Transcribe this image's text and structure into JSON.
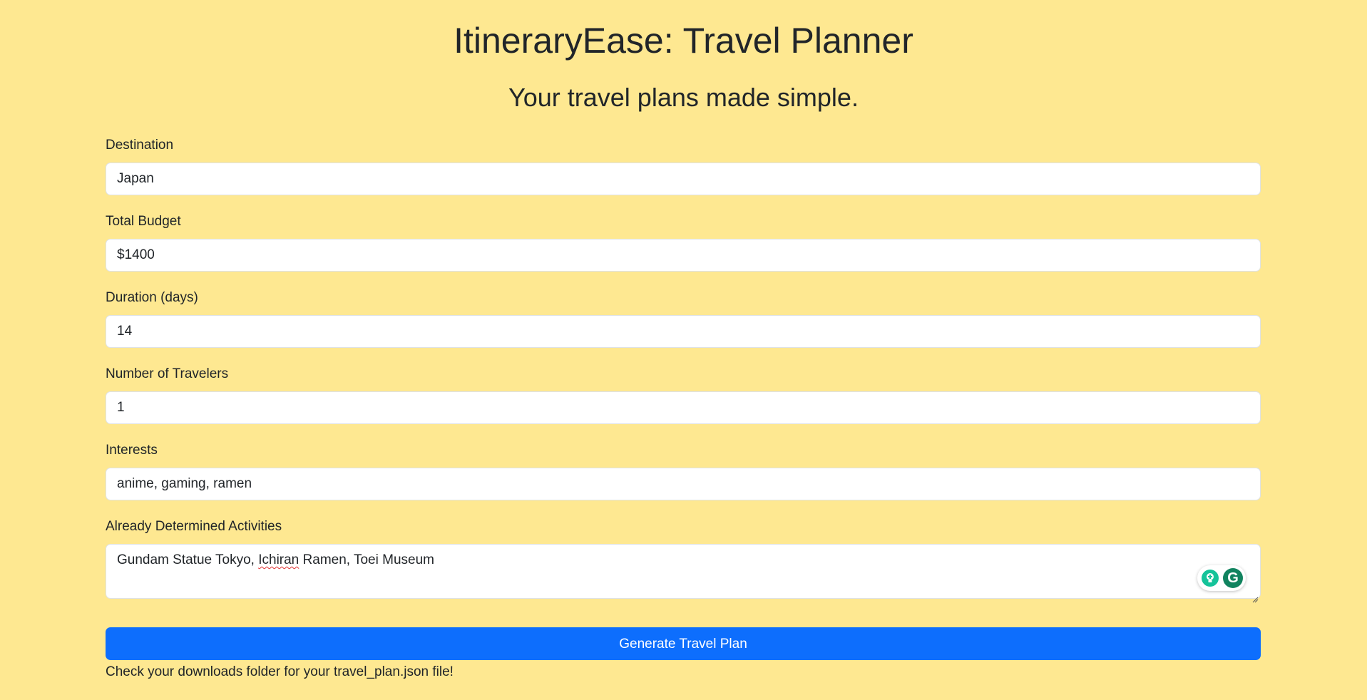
{
  "header": {
    "title": "ItineraryEase: Travel Planner",
    "subtitle": "Your travel plans made simple."
  },
  "form": {
    "destination": {
      "label": "Destination",
      "value": "Japan"
    },
    "budget": {
      "label": "Total Budget",
      "value": "$1400"
    },
    "duration": {
      "label": "Duration (days)",
      "value": "14"
    },
    "travelers": {
      "label": "Number of Travelers",
      "value": "1"
    },
    "interests": {
      "label": "Interests",
      "value": "anime, gaming, ramen"
    },
    "activities": {
      "label": "Already Determined Activities",
      "value_part1": "Gundam Statue Tokyo, ",
      "value_misspelled": "Ichiran",
      "value_part2": " Ramen, Toei Museum"
    },
    "submit_label": "Generate Travel Plan",
    "status_message": "Check your downloads folder for your travel_plan.json file!"
  },
  "theme": {
    "background": "#fee891",
    "primary": "#0d6efd",
    "text": "#212529",
    "grammarly_green": "#15c39a"
  },
  "icons": {
    "grammarly_suggestion": "lightbulb-icon",
    "grammarly_logo": "grammarly-g-icon",
    "resize": "resize-handle-icon"
  }
}
